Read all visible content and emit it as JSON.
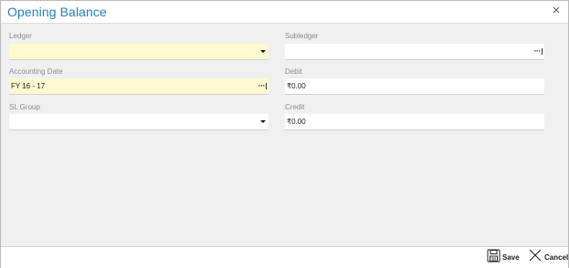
{
  "dialog": {
    "title": "Opening Balance"
  },
  "fields": {
    "ledger": {
      "label": "Ledger",
      "value": ""
    },
    "subledger": {
      "label": "Subledger",
      "value": ""
    },
    "accounting_date": {
      "label": "Accounting Date",
      "value": "FY 16 - 17"
    },
    "debit": {
      "label": "Debit",
      "value": "₹0.00"
    },
    "sl_group": {
      "label": "SL Group",
      "value": ""
    },
    "credit": {
      "label": "Credit",
      "value": "₹0.00"
    }
  },
  "footer": {
    "save_label": "Save",
    "cancel_label": "Cancel"
  },
  "icons": {
    "close": "close-icon",
    "dropdown": "chevron-down-icon",
    "lookup": "ellipsis-icon",
    "save": "floppy-disk-icon",
    "cancel": "x-icon"
  },
  "colors": {
    "title": "#1f7fc6",
    "required_field": "#fdf9cf",
    "dialog_background": "#f0f0f0"
  }
}
